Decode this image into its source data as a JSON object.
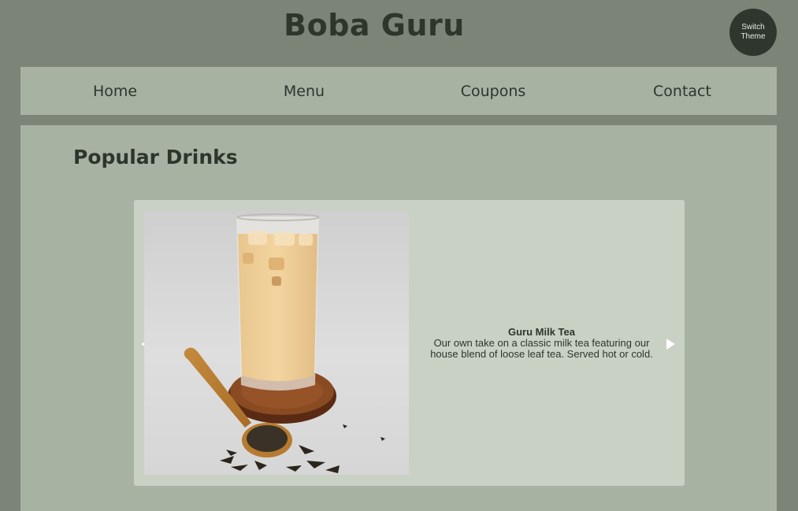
{
  "header": {
    "title": "Boba Guru",
    "theme_button_label": "Switch Theme"
  },
  "nav": {
    "items": [
      "Home",
      "Menu",
      "Coupons",
      "Contact"
    ]
  },
  "main": {
    "heading": "Popular Drinks",
    "carousel": {
      "slide": {
        "image_icon": "milk-tea-photo",
        "title": "Guru Milk Tea",
        "description": "Our own take on a classic milk tea featuring our house blend of loose leaf tea. Served hot or cold."
      }
    }
  },
  "colors": {
    "background": "#7b8477",
    "panel": "#a8b2a3",
    "carousel_bg": "#c9d0c4",
    "text_dark": "#2e362c",
    "theme_button": "#2f362d"
  }
}
